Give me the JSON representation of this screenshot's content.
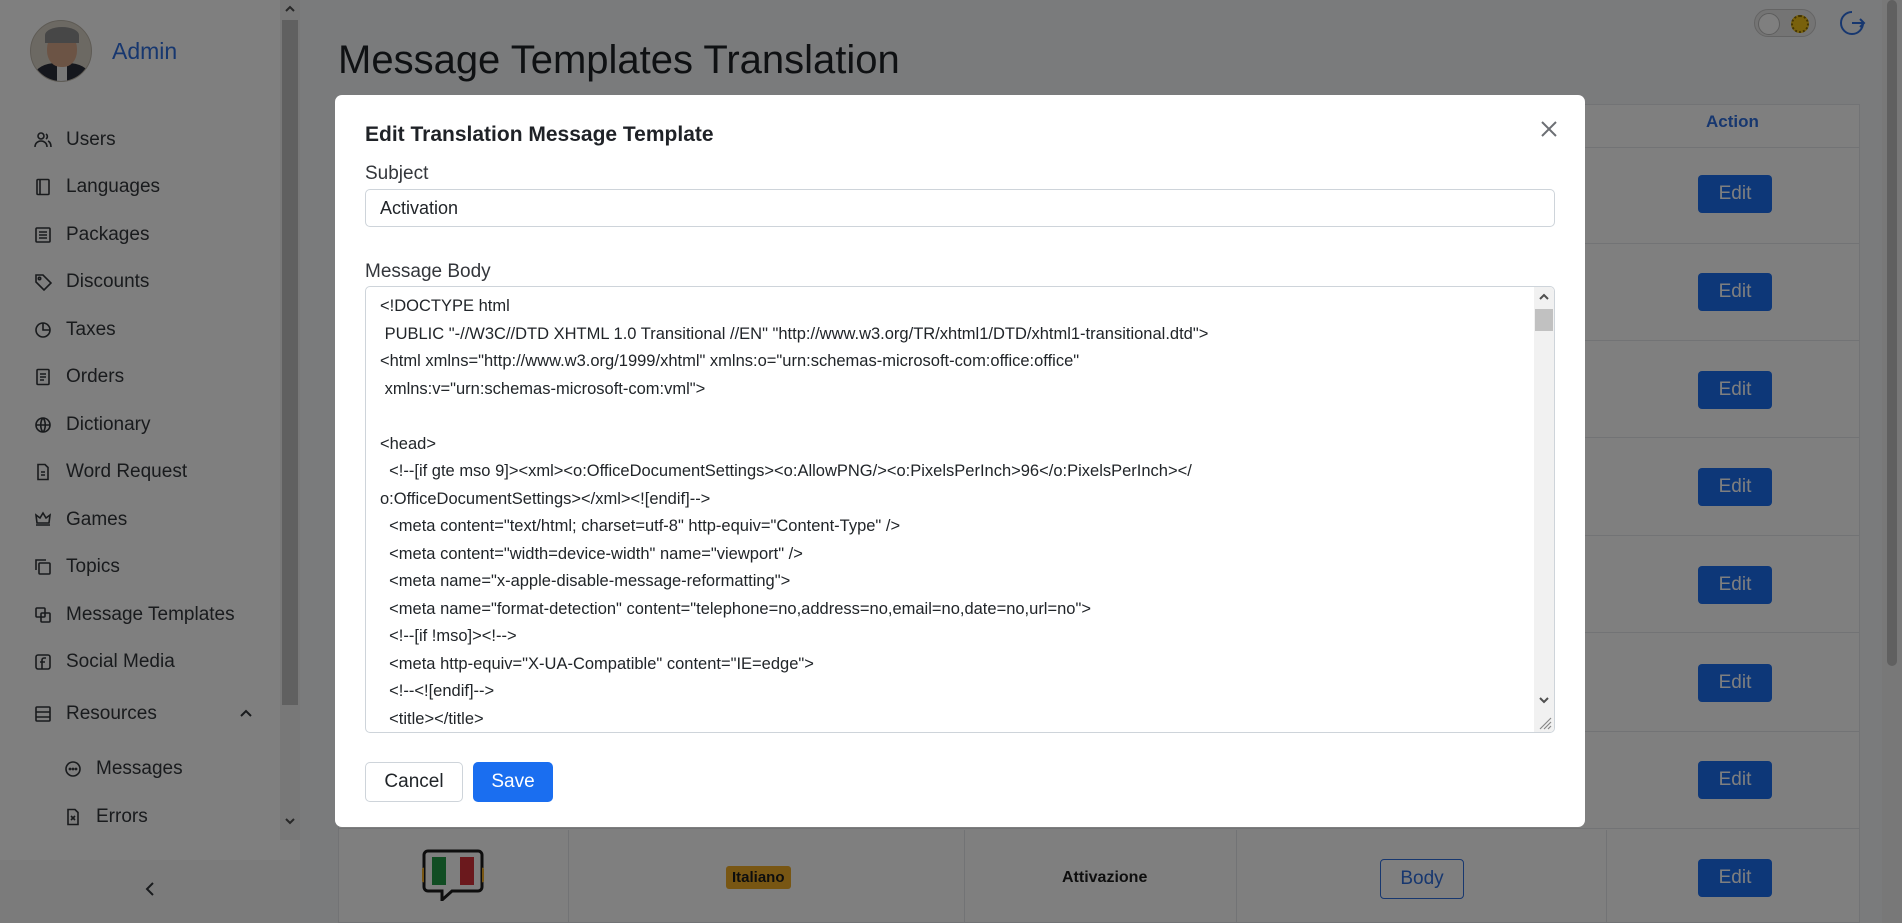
{
  "sidebar": {
    "user_name": "Admin",
    "items": [
      {
        "label": "Users",
        "icon": "users-icon"
      },
      {
        "label": "Languages",
        "icon": "book-icon"
      },
      {
        "label": "Packages",
        "icon": "package-icon"
      },
      {
        "label": "Discounts",
        "icon": "tag-icon"
      },
      {
        "label": "Taxes",
        "icon": "pie-chart-icon"
      },
      {
        "label": "Orders",
        "icon": "receipt-icon"
      },
      {
        "label": "Dictionary",
        "icon": "globe-icon"
      },
      {
        "label": "Word Request",
        "icon": "document-icon"
      },
      {
        "label": "Games",
        "icon": "crown-icon"
      },
      {
        "label": "Topics",
        "icon": "copy-icon"
      },
      {
        "label": "Message Templates",
        "icon": "templates-icon"
      },
      {
        "label": "Social Media",
        "icon": "facebook-icon"
      }
    ],
    "group": {
      "label": "Resources",
      "icon": "server-icon",
      "expanded": true
    },
    "subitems": [
      {
        "label": "Messages",
        "icon": "message-icon"
      },
      {
        "label": "Errors",
        "icon": "error-file-icon"
      }
    ],
    "collapse_icon": "chevron-left-icon"
  },
  "header": {
    "page_title": "Message Templates Translation",
    "theme_toggle": "sun-icon",
    "logout_icon": "logout-icon"
  },
  "table": {
    "action_header": "Action",
    "edit_label": "Edit",
    "last_row": {
      "language": "Italiano",
      "subject": "Attivazione",
      "body_label": "Body"
    }
  },
  "modal": {
    "title": "Edit Translation Message Template",
    "subject_label": "Subject",
    "subject_value": "Activation",
    "body_label": "Message Body",
    "body_lines": [
      "<!DOCTYPE html",
      " PUBLIC \"-//W3C//DTD XHTML 1.0 Transitional //EN\" \"http://www.w3.org/TR/xhtml1/DTD/xhtml1-transitional.dtd\">",
      "<html xmlns=\"http://www.w3.org/1999/xhtml\" xmlns:o=\"urn:schemas-microsoft-com:office:office\"",
      " xmlns:v=\"urn:schemas-microsoft-com:vml\">",
      "",
      "<head>",
      "  <!--[if gte mso 9]><xml><o:OfficeDocumentSettings><o:AllowPNG/><o:PixelsPerInch>96</o:PixelsPerInch></",
      "o:OfficeDocumentSettings></xml><![endif]-->",
      "  <meta content=\"text/html; charset=utf-8\" http-equiv=\"Content-Type\" />",
      "  <meta content=\"width=device-width\" name=\"viewport\" />",
      "  <meta name=\"x-apple-disable-message-reformatting\">",
      "  <meta name=\"format-detection\" content=\"telephone=no,address=no,email=no,date=no,url=no\">",
      "  <!--[if !mso]><!-->",
      "  <meta http-equiv=\"X-UA-Compatible\" content=\"IE=edge\">",
      "  <!--<![endif]-->",
      "  <title></title>"
    ],
    "cancel_label": "Cancel",
    "save_label": "Save"
  },
  "colors": {
    "accent": "#1a6ef0",
    "badge": "#f0ad26"
  }
}
